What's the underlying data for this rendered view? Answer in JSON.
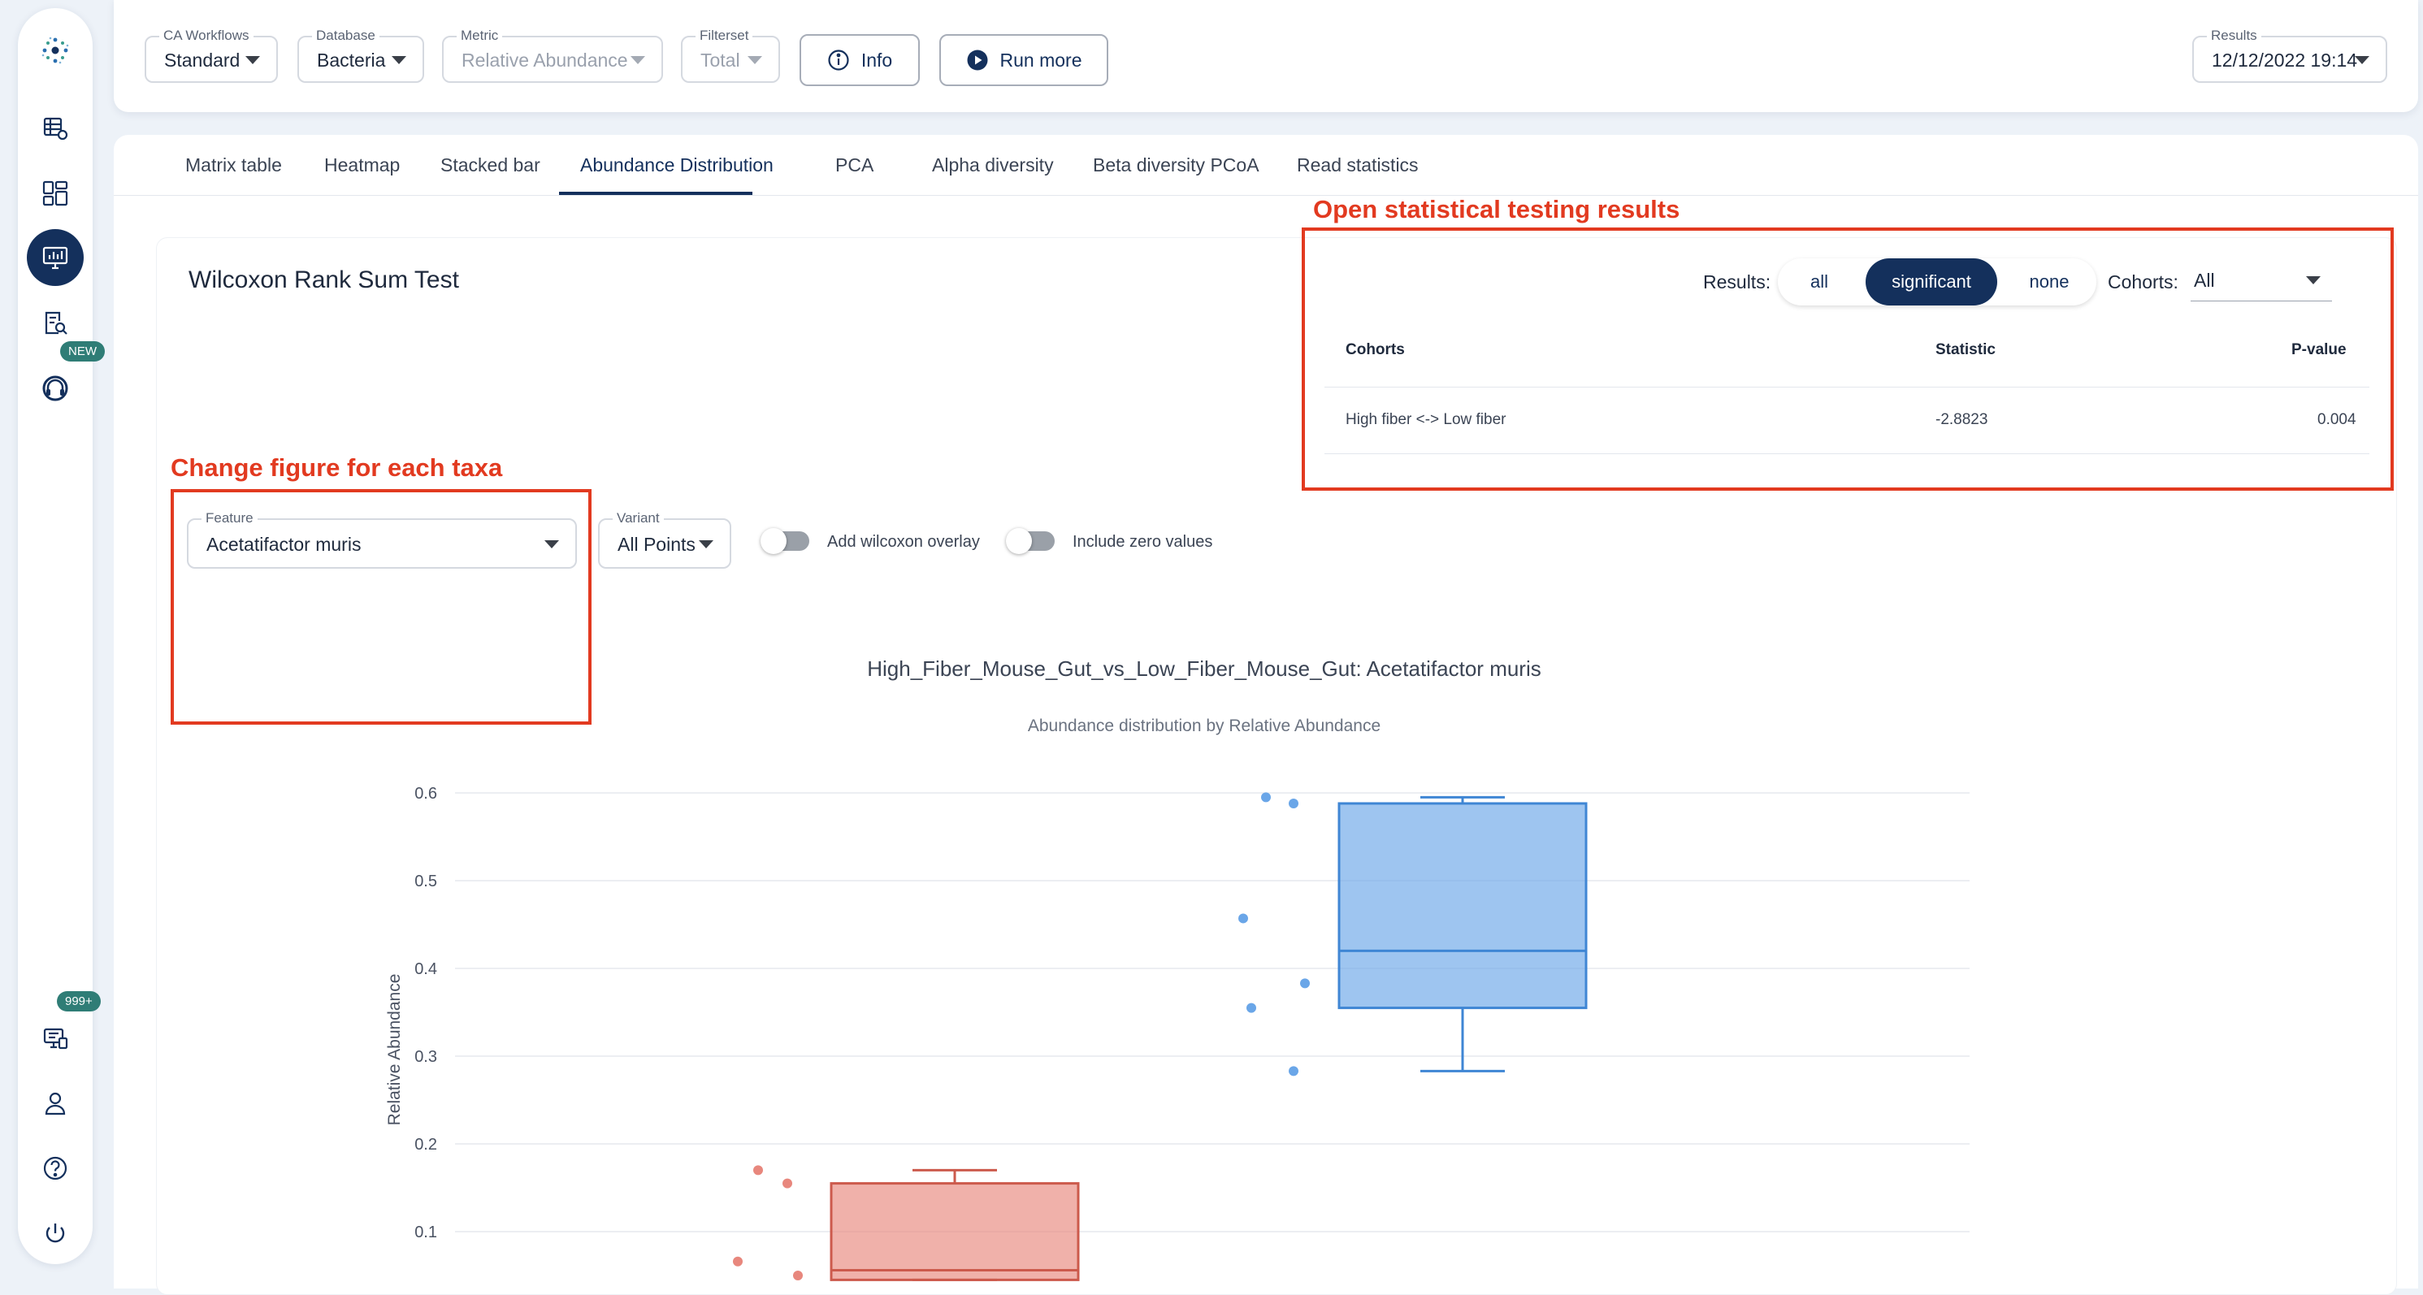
{
  "sidebar": {
    "items": [
      {
        "icon": "logo-dots-icon"
      },
      {
        "icon": "table-gear-icon"
      },
      {
        "icon": "dashboard-grid-icon"
      },
      {
        "icon": "monitor-chart-icon",
        "active": true
      },
      {
        "icon": "document-search-icon"
      },
      {
        "icon": "headset-icon",
        "badge": "NEW"
      },
      {
        "icon": "monitor-list-icon",
        "badge": "999+"
      },
      {
        "icon": "user-icon"
      },
      {
        "icon": "help-icon"
      },
      {
        "icon": "power-icon"
      }
    ],
    "badge_new": "NEW",
    "badge_count": "999+"
  },
  "toolbar": {
    "workflows": {
      "label": "CA Workflows",
      "value": "Standard"
    },
    "database": {
      "label": "Database",
      "value": "Bacteria"
    },
    "metric": {
      "label": "Metric",
      "value": "Relative Abundance"
    },
    "filterset": {
      "label": "Filterset",
      "value": "Total"
    },
    "info_label": "Info",
    "run_more_label": "Run more",
    "results": {
      "label": "Results",
      "value": "12/12/2022 19:14"
    }
  },
  "tabs": [
    {
      "label": "Matrix table"
    },
    {
      "label": "Heatmap"
    },
    {
      "label": "Stacked bar"
    },
    {
      "label": "Abundance Distribution",
      "active": true
    },
    {
      "label": "PCA"
    },
    {
      "label": "Alpha diversity"
    },
    {
      "label": "Beta diversity PCoA"
    },
    {
      "label": "Read statistics"
    }
  ],
  "card_title": "Wilcoxon Rank Sum Test",
  "annotations": {
    "results": "Open statistical testing results",
    "feature": "Change figure for each taxa"
  },
  "stats": {
    "results_label": "Results:",
    "options": [
      "all",
      "significant",
      "none"
    ],
    "selected": "significant",
    "cohorts_label": "Cohorts:",
    "cohorts_value": "All",
    "columns": [
      "Cohorts",
      "Statistic",
      "P-value"
    ],
    "rows": [
      {
        "cohorts": "High fiber <-> Low fiber",
        "statistic": "-2.8823",
        "pvalue": "0.004"
      }
    ]
  },
  "controls": {
    "feature": {
      "label": "Feature",
      "value": "Acetatifactor muris"
    },
    "variant": {
      "label": "Variant",
      "value": "All Points"
    },
    "wilcoxon_toggle": {
      "label": "Add wilcoxon overlay",
      "on": false
    },
    "zero_toggle": {
      "label": "Include zero values",
      "on": false
    }
  },
  "chart_data": {
    "type": "box",
    "title": "High_Fiber_Mouse_Gut_vs_Low_Fiber_Mouse_Gut: Acetatifactor muris",
    "subtitle": "Abundance distribution by Relative Abundance",
    "ylabel": "Relative Abundance",
    "yticks": [
      0.1,
      0.2,
      0.3,
      0.4,
      0.5,
      0.6
    ],
    "ylim": [
      0.045,
      0.65
    ],
    "grid": true,
    "series": [
      {
        "color": "#e8877d",
        "box": {
          "q1": 0.045,
          "median": 0.056,
          "q3": 0.155,
          "whisker_low": 0.045,
          "whisker_high": 0.17
        },
        "points": [
          0.17,
          0.155,
          0.066,
          0.05
        ]
      },
      {
        "color": "#6aa6e8",
        "box": {
          "q1": 0.355,
          "median": 0.42,
          "q3": 0.588,
          "whisker_low": 0.283,
          "whisker_high": 0.595
        },
        "points": [
          0.595,
          0.588,
          0.457,
          0.383,
          0.355,
          0.283
        ]
      }
    ]
  }
}
